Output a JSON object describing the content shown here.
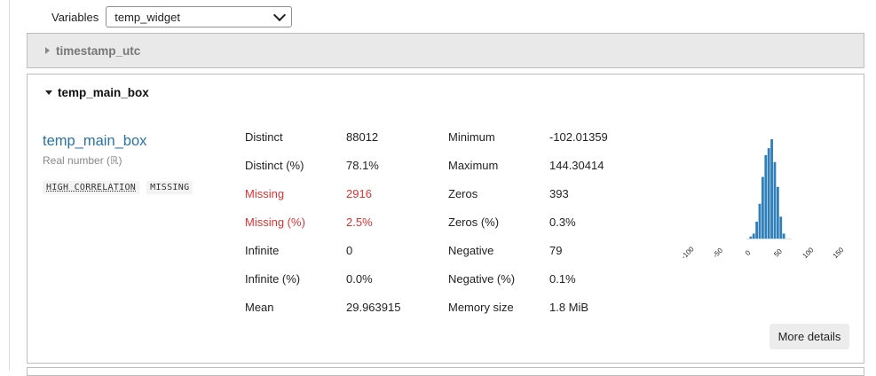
{
  "variables": {
    "label": "Variables",
    "selected": "temp_widget"
  },
  "collapsed_panel": {
    "title": "timestamp_utc"
  },
  "open_panel": {
    "title": "temp_main_box",
    "var_name": "temp_main_box",
    "var_type": "Real number (ℝ)",
    "badges": [
      "HIGH CORRELATION",
      "MISSING"
    ],
    "stats_left": [
      {
        "label": "Distinct",
        "value": "88012",
        "alert": false
      },
      {
        "label": "Distinct (%)",
        "value": "78.1%",
        "alert": false
      },
      {
        "label": "Missing",
        "value": "2916",
        "alert": true
      },
      {
        "label": "Missing (%)",
        "value": "2.5%",
        "alert": true
      },
      {
        "label": "Infinite",
        "value": "0",
        "alert": false
      },
      {
        "label": "Infinite (%)",
        "value": "0.0%",
        "alert": false
      },
      {
        "label": "Mean",
        "value": "29.963915",
        "alert": false
      }
    ],
    "stats_right": [
      {
        "label": "Minimum",
        "value": "-102.01359"
      },
      {
        "label": "Maximum",
        "value": "144.30414"
      },
      {
        "label": "Zeros",
        "value": "393"
      },
      {
        "label": "Zeros (%)",
        "value": "0.3%"
      },
      {
        "label": "Negative",
        "value": "79"
      },
      {
        "label": "Negative (%)",
        "value": "0.1%"
      },
      {
        "label": "Memory size",
        "value": "1.8 MiB"
      }
    ],
    "more_button": "More details"
  },
  "colors": {
    "accent": "#2a73a8",
    "alert": "#e03131",
    "bar": "#2f7fba"
  },
  "chart_data": {
    "type": "bar",
    "title": "",
    "xlabel": "",
    "ylabel": "",
    "x_ticks": [
      -100,
      -50,
      0,
      50,
      100,
      150
    ],
    "xlim": [
      -120,
      160
    ],
    "bins": [
      {
        "x": 0,
        "h": 0.02
      },
      {
        "x": 5,
        "h": 0.05
      },
      {
        "x": 10,
        "h": 0.17
      },
      {
        "x": 15,
        "h": 0.35
      },
      {
        "x": 20,
        "h": 0.62
      },
      {
        "x": 25,
        "h": 0.84
      },
      {
        "x": 30,
        "h": 0.91
      },
      {
        "x": 35,
        "h": 1.0
      },
      {
        "x": 40,
        "h": 0.77
      },
      {
        "x": 45,
        "h": 0.52
      },
      {
        "x": 50,
        "h": 0.22
      },
      {
        "x": 55,
        "h": 0.05
      }
    ],
    "grid": false
  }
}
